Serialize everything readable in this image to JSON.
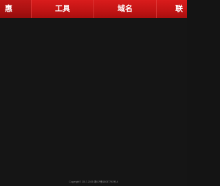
{
  "nav": {
    "items": [
      {
        "label": "惠",
        "active": true
      },
      {
        "label": "工具",
        "active": false
      },
      {
        "label": "域名",
        "active": false
      },
      {
        "label": "联",
        "active": false
      }
    ]
  },
  "footer": {
    "copyright": "Copyright© 2017-2025 湘ICP备18037791号-4"
  },
  "colors": {
    "nav_red": "#c91616",
    "nav_active": "#a30d0d",
    "background": "#151515",
    "footer_text": "#8a8a8a"
  }
}
